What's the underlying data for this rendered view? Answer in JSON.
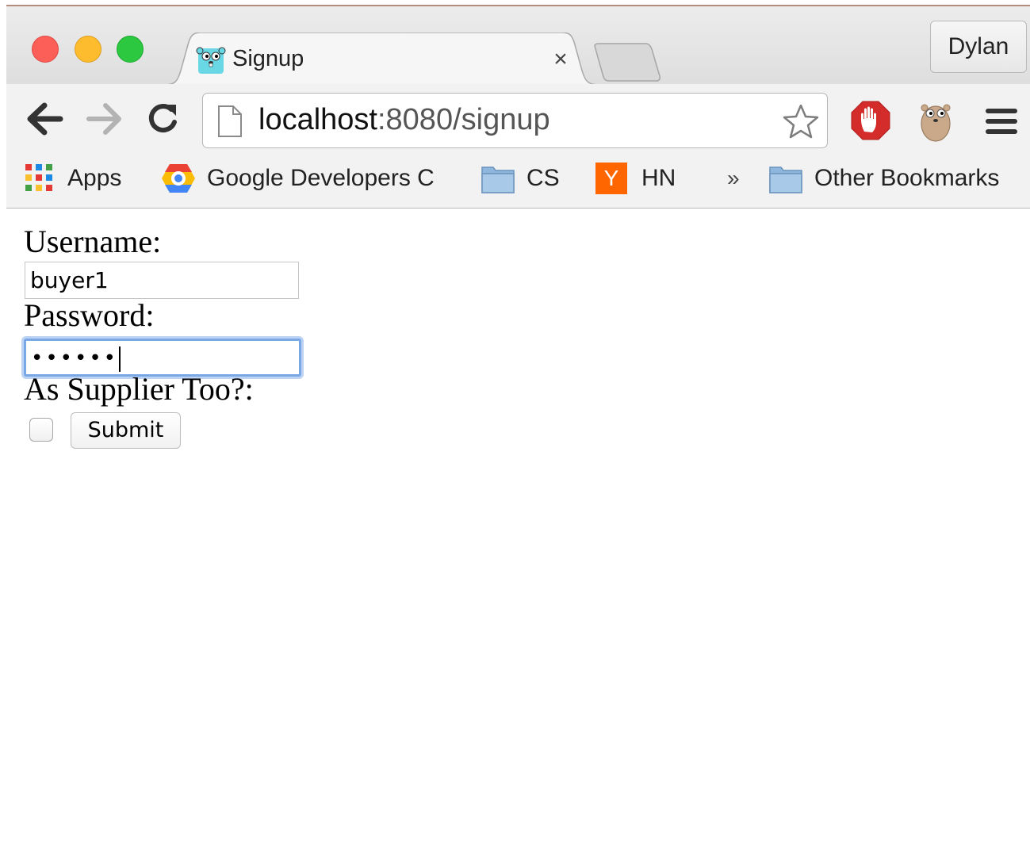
{
  "browser": {
    "tab": {
      "title": "Signup",
      "close_glyph": "×",
      "favicon": "gopher-icon"
    },
    "profile": {
      "name": "Dylan"
    },
    "omnibox": {
      "host": "localhost",
      "rest": ":8080/signup"
    },
    "bookmarks": {
      "apps": "Apps",
      "google_developers": "Google Developers C",
      "cs": "CS",
      "hn_badge": "Y",
      "hn": "HN",
      "overflow": "»",
      "other": "Other Bookmarks"
    }
  },
  "form": {
    "username_label": "Username:",
    "username_value": "buyer1",
    "password_label": "Password:",
    "password_value": "••••••",
    "supplier_label": "As Supplier Too?:",
    "submit_label": "Submit"
  },
  "colors": {
    "hn_orange": "#ff6600",
    "focus_ring": "#7aa7e6"
  }
}
